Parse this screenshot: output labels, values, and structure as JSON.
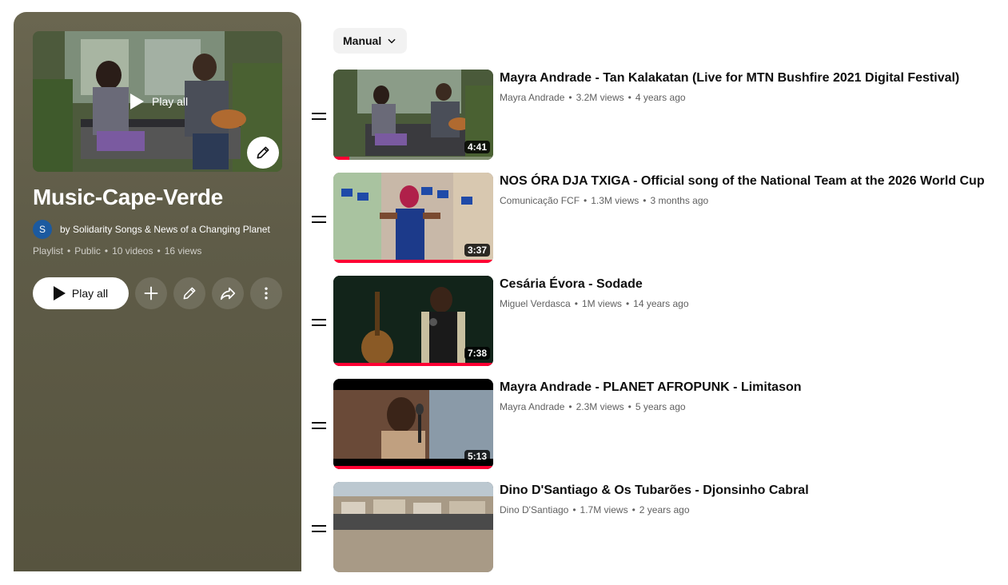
{
  "playlist": {
    "title": "Music-Cape-Verde",
    "avatar_letter": "S",
    "owner": "by Solidarity Songs & News of a Changing Planet",
    "type": "Playlist",
    "visibility": "Public",
    "video_count": "10 videos",
    "views": "16 views",
    "hero_play_label": "Play all",
    "play_all_label": "Play all",
    "accent": "#5f5c48"
  },
  "sort": {
    "label": "Manual"
  },
  "videos": [
    {
      "title": "Mayra Andrade - Tan Kalakatan (Live for MTN Bushfire 2021 Digital Festival)",
      "channel": "Mayra Andrade",
      "views": "3.2M views",
      "age": "4 years ago",
      "duration": "4:41",
      "progress": 0.1
    },
    {
      "title": "NOS ÓRA DJA TXIGA - Official song of the National Team at the 2026 World Cup",
      "channel": "Comunicação FCF",
      "views": "1.3M views",
      "age": "3 months ago",
      "duration": "3:37",
      "progress": 1.0
    },
    {
      "title": "Cesária Évora - Sodade",
      "channel": "Miguel Verdasca",
      "views": "1M views",
      "age": "14 years ago",
      "duration": "7:38",
      "progress": 1.0
    },
    {
      "title": "Mayra Andrade - PLANET AFROPUNK - Limitason",
      "channel": "Mayra Andrade",
      "views": "2.3M views",
      "age": "5 years ago",
      "duration": "5:13",
      "progress": 1.0
    },
    {
      "title": "Dino D'Santiago & Os Tubarões - Djonsinho Cabral",
      "channel": "Dino D'Santiago",
      "views": "1.7M views",
      "age": "2 years ago",
      "duration": "",
      "progress": 0
    }
  ]
}
